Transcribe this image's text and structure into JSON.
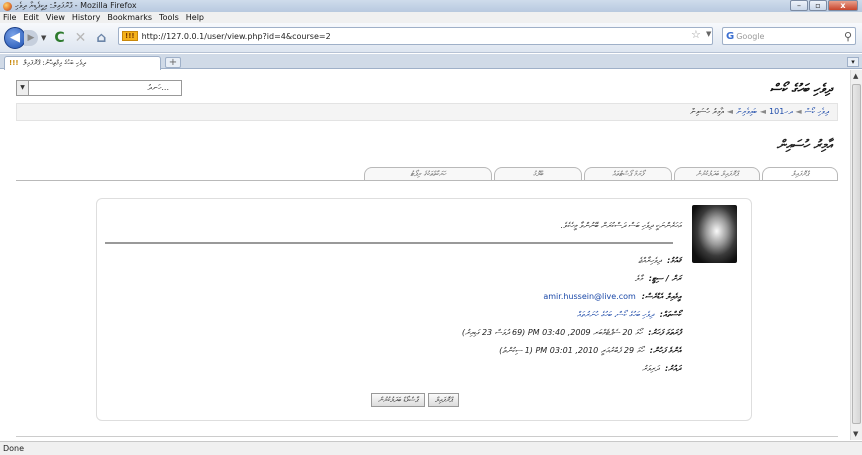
{
  "window": {
    "title": "ޕްރޮފައިލް: އިކީޕެޑިޔާ ދިވެހި - Mozilla Firefox",
    "btn_min": "–",
    "btn_max": "▫",
    "btn_close": "x"
  },
  "menu": [
    "File",
    "Edit",
    "View",
    "History",
    "Bookmarks",
    "Tools",
    "Help"
  ],
  "nav": {
    "back": "◀",
    "forward": "▶",
    "dropdown": "▼",
    "reload": "C",
    "stop": "✕",
    "home": "⌂",
    "url_favicon": "!!!",
    "url": "http://127.0.0.1/user/view.php?id=4&course=2",
    "star": "☆",
    "url_dropdown": "▼",
    "search_engine": "G",
    "search_placeholder": "Google",
    "search_icon": "⚲"
  },
  "tabs_bar": {
    "favicon": "!!!",
    "tab_title": "ދިވެހި ބަހުގެ އިމްތިޙާނު: ޕްރޮފައިލް",
    "new_tab": "+",
    "scroll": "▾"
  },
  "page": {
    "jump_value": "ހަނދު...",
    "jump_arrow": "▼",
    "site_title": "ދިވެހި ބަހުގެ ކޯސް",
    "breadcrumb": [
      "ދިވެހި ކޯސް",
      "ދހ101",
      "ބައިވެރިން",
      "އާމިރު ހުސައިން"
    ],
    "breadcrumb_sep": "◄",
    "page_heading": "އާމިރު ހުސައިން",
    "tabs": [
      "ޕްރޮފައިލް",
      "ޕްރޮފައިލް ބަދަލުކުރުން",
      "ފޯރަމް ޕޯސްޓްތައް",
      "ބްލޮގު",
      "ހަރަކާތްތަކުގެ ރިޕޯޓު"
    ],
    "description": "އަހަރެންނަކީ ދިވެހި ބަސް ދަސްކުރަން ބޭނުންވާ މީހެކެވެ.",
    "rows": [
      {
        "label": "ޤައުމު:",
        "value": "ދިވެހިރާއްޖެ",
        "link": false
      },
      {
        "label": "ރަށް / ސިޓީ:",
        "value": "މާލެ",
        "link": false
      },
      {
        "label": "އީމެއިލް އެޑްރެސް:",
        "value": "amir.hussein@live.com",
        "link": true
      },
      {
        "label": "ކޯސްތައް:",
        "value": "ދިވެހި ބަހުގެ ކޯސް، ބަހުގެ ހުނަރުތައް",
        "link": true
      },
      {
        "label": "ފުރަތަމަ ފަހަރު:",
        "value": "ހޯމަ 20 ސެޕްޓެމްބަރ 2009, 03:40 PM (69 ދުވަސް 23 ގަޑިއިރު)",
        "link": false
      },
      {
        "label": "އެންމެ ފަހުން:",
        "value": "ހޯމަ 29 ފެބްރުއަރީ 2010, 03:01 PM (1 ސިކުންތު)",
        "link": false
      },
      {
        "label": "ދައުރު:",
        "value": "ދަރިވަރު",
        "link": false
      }
    ],
    "buttons": [
      "ޕާސްވޯޑް ބަދަލުކުރުން",
      "ޕްރޮފައިލް"
    ]
  },
  "status": {
    "text": "Done"
  },
  "colors": {
    "link": "#1a48a8",
    "chrome": "#d0dae7"
  }
}
